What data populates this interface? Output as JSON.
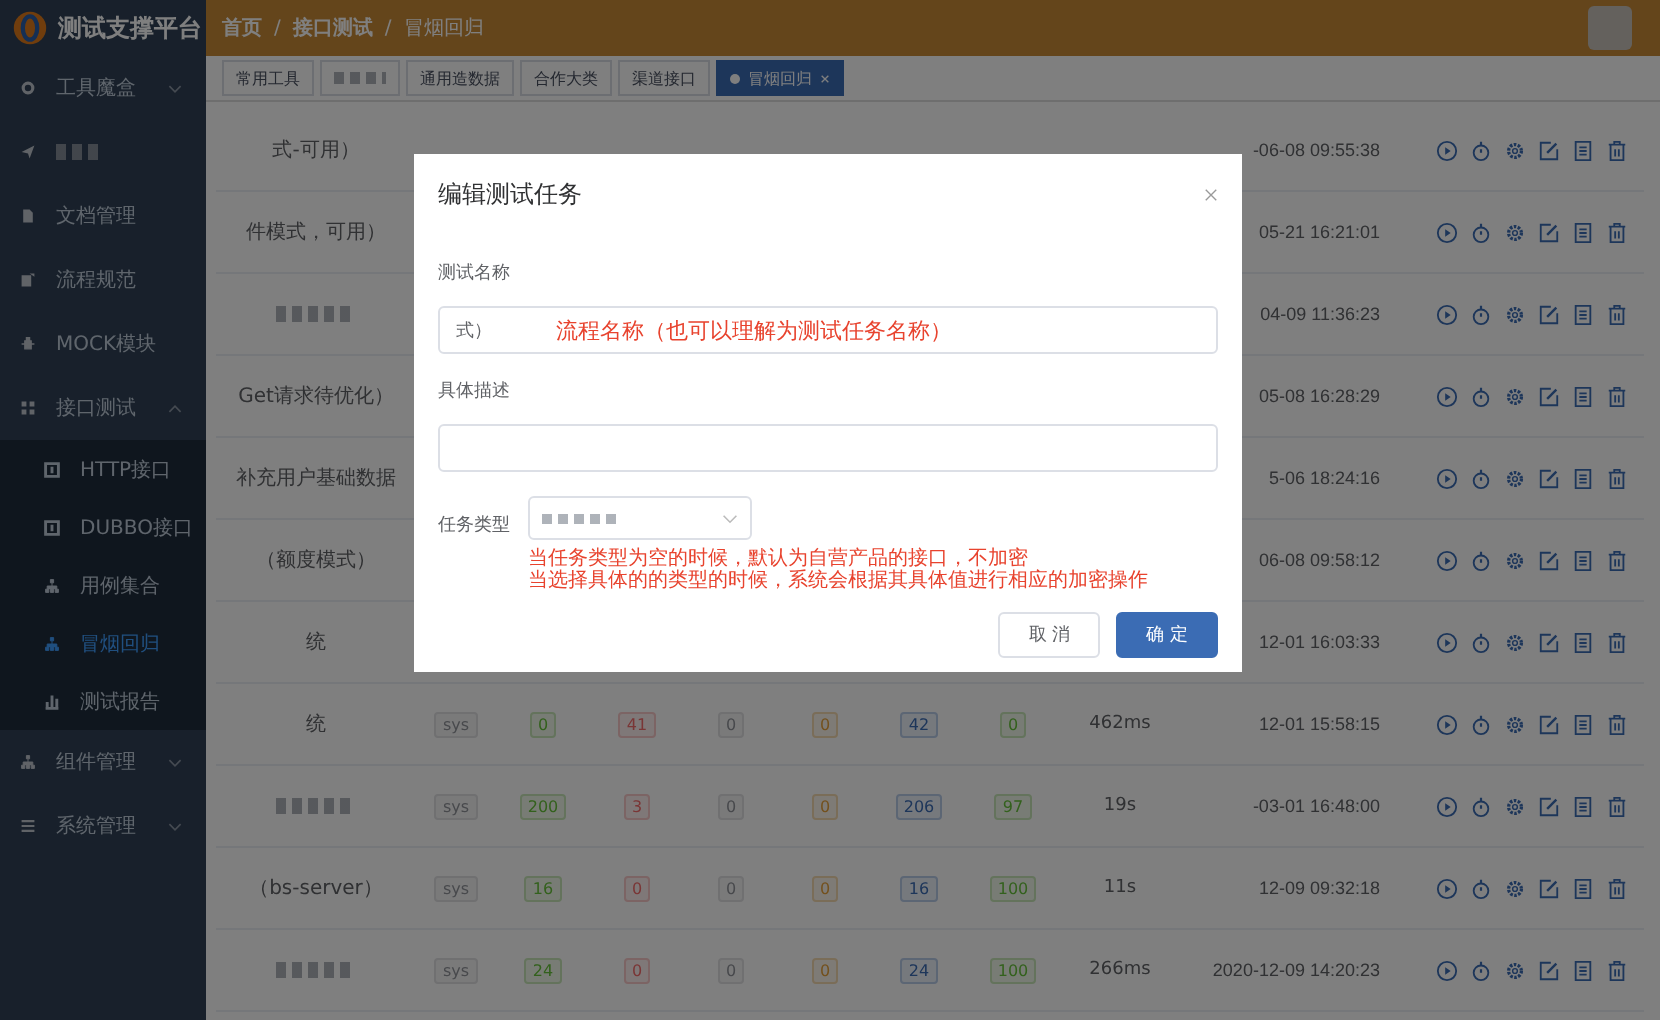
{
  "header": {
    "title": "测试支撑平台",
    "separator": "/",
    "breadcrumb": [
      {
        "label": "首页",
        "current": false
      },
      {
        "label": "接口测试",
        "current": false
      },
      {
        "label": "冒烟回归",
        "current": true
      }
    ]
  },
  "sidebar": {
    "items": [
      {
        "label": "工具魔盒",
        "expanded": false
      },
      {
        "redacted": true
      },
      {
        "label": "文档管理"
      },
      {
        "label": "流程规范"
      },
      {
        "label": "MOCK模块"
      },
      {
        "label": "接口测试",
        "expanded": true,
        "children": [
          {
            "label": "HTTP接口",
            "selected": false
          },
          {
            "label": "DUBBO接口",
            "selected": false
          },
          {
            "label": "用例集合",
            "selected": false
          },
          {
            "label": "冒烟回归",
            "selected": true
          },
          {
            "label": "测试报告",
            "selected": false
          }
        ]
      },
      {
        "label": "组件管理",
        "expanded": false
      },
      {
        "label": "系统管理",
        "expanded": false
      }
    ]
  },
  "tabs": [
    {
      "label": "常用工具",
      "selected": false
    },
    {
      "selected": false
    },
    {
      "label": "通用造数据",
      "selected": false
    },
    {
      "label": "合作大类",
      "selected": false
    },
    {
      "label": "渠道接口",
      "selected": false
    },
    {
      "label": "冒烟回归",
      "selected": true
    }
  ],
  "table": {
    "rows": [
      {
        "name": "式-可用）",
        "time": "-06-08 09:55:38"
      },
      {
        "name": "件模式，可用）",
        "time": "05-21 16:21:01"
      },
      {
        "time": "04-09 11:36:23"
      },
      {
        "name": "Get请求待优化）",
        "time": "05-08 16:28:29"
      },
      {
        "name": "补充用户基础数据",
        "time": "5-06 18:24:16"
      },
      {
        "name": "（额度模式）",
        "time": "06-08 09:58:12"
      },
      {
        "name": "统",
        "time": "12-01 16:03:33"
      },
      {
        "name": "统",
        "tag": "sys",
        "counts": [
          "0",
          "41",
          "0",
          "0",
          "42",
          "0"
        ],
        "duration": "462ms",
        "time": "12-01 15:58:15"
      },
      {
        "tag": "sys",
        "counts": [
          "200",
          "3",
          "0",
          "0",
          "206",
          "97"
        ],
        "duration": "19s",
        "time": "-03-01 16:48:00"
      },
      {
        "name": "（bs-server）",
        "tag": "sys",
        "counts": [
          "16",
          "0",
          "0",
          "0",
          "16",
          "100"
        ],
        "duration": "11s",
        "time": "12-09 09:32:18"
      },
      {
        "tag": "sys",
        "counts": [
          "24",
          "0",
          "0",
          "0",
          "24",
          "100"
        ],
        "duration": "266ms",
        "time": "2020-12-09 14:20:23"
      }
    ]
  },
  "modal": {
    "title": "编辑测试任务",
    "fields": [
      {
        "label": "测试名称",
        "kind": "text",
        "value": "式）",
        "note": "流程名称（也可以理解为测试任务名称）"
      },
      {
        "label": "具体描述",
        "kind": "text"
      },
      {
        "label": "任务类型",
        "kind": "select",
        "notes": [
          "当任务类型为空的时候，默认为自营产品的接口，不加密",
          "当选择具体的的类型的时候，系统会根据其具体值进行相应的加密操作"
        ]
      }
    ],
    "buttons": [
      {
        "label": "取 消",
        "primary": false
      },
      {
        "label": "确 定",
        "primary": true
      }
    ]
  }
}
